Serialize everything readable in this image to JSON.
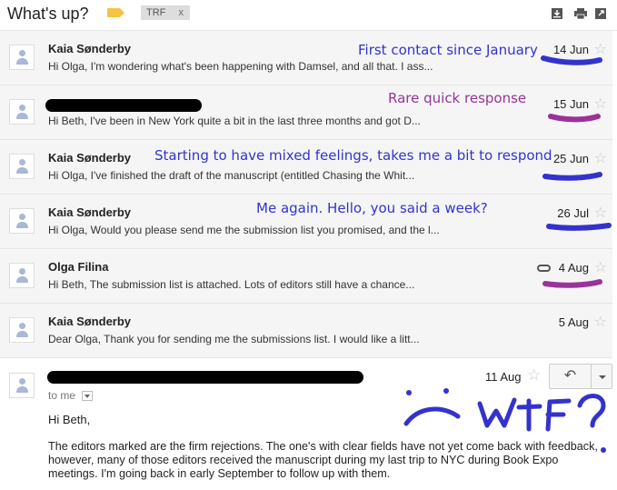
{
  "header": {
    "title": "What's up?",
    "label_chip": "TRF",
    "label_chip_close": "x",
    "tools": [
      "download-icon",
      "print-icon",
      "open-in-new-window-icon"
    ]
  },
  "threads": [
    {
      "sender": "Kaia Sønderby",
      "snippet": "Hi Olga, I'm wondering what's been happening with Damsel, and all that. I ass...",
      "date": "14 Jun",
      "annotation": "First contact since January",
      "annotation_color": "#3333cc"
    },
    {
      "sender": "",
      "snippet": "Hi Beth, I've been in New York quite a bit in the last three months and got D...",
      "date": "15 Jun",
      "annotation": "Rare quick response",
      "annotation_color": "#993399"
    },
    {
      "sender": "Kaia Sønderby",
      "snippet": "Hi Olga, I've finished the draft of the manuscript (entitled Chasing the Whit...",
      "date": "25 Jun",
      "annotation": "Starting to have mixed feelings, takes me a bit to respond",
      "annotation_color": "#3333cc"
    },
    {
      "sender": "Kaia Sønderby",
      "snippet": "Hi Olga, Would you please send me the submission list you promised, and the l...",
      "date": "26 Jul",
      "annotation": "Me again. Hello, you said a week?",
      "annotation_color": "#3333cc"
    },
    {
      "sender": "Olga Filina",
      "snippet": "Hi Beth, The submission list is attached. Lots of editors still have a chance...",
      "date": "4 Aug",
      "has_attachment": true
    },
    {
      "sender": "Kaia Sønderby",
      "snippet": "Dear Olga, Thank you for sending me the submissions list. I would like a litt...",
      "date": "5 Aug"
    }
  ],
  "open_message": {
    "date": "11 Aug",
    "to": "to me",
    "greeting": "Hi Beth,",
    "body": "The editors marked are the firm rejections. The one's with clear fields have not yet come back with feedback, however, many of those editors received the manuscript during my last trip to NYC during Book Expo meetings. I'm going back in early September to follow up with them.",
    "handwritten_note": "WTF?"
  },
  "colors": {
    "annotation_blue": "#3333cc",
    "annotation_purple": "#993399",
    "row_background": "#f5f5f5"
  }
}
